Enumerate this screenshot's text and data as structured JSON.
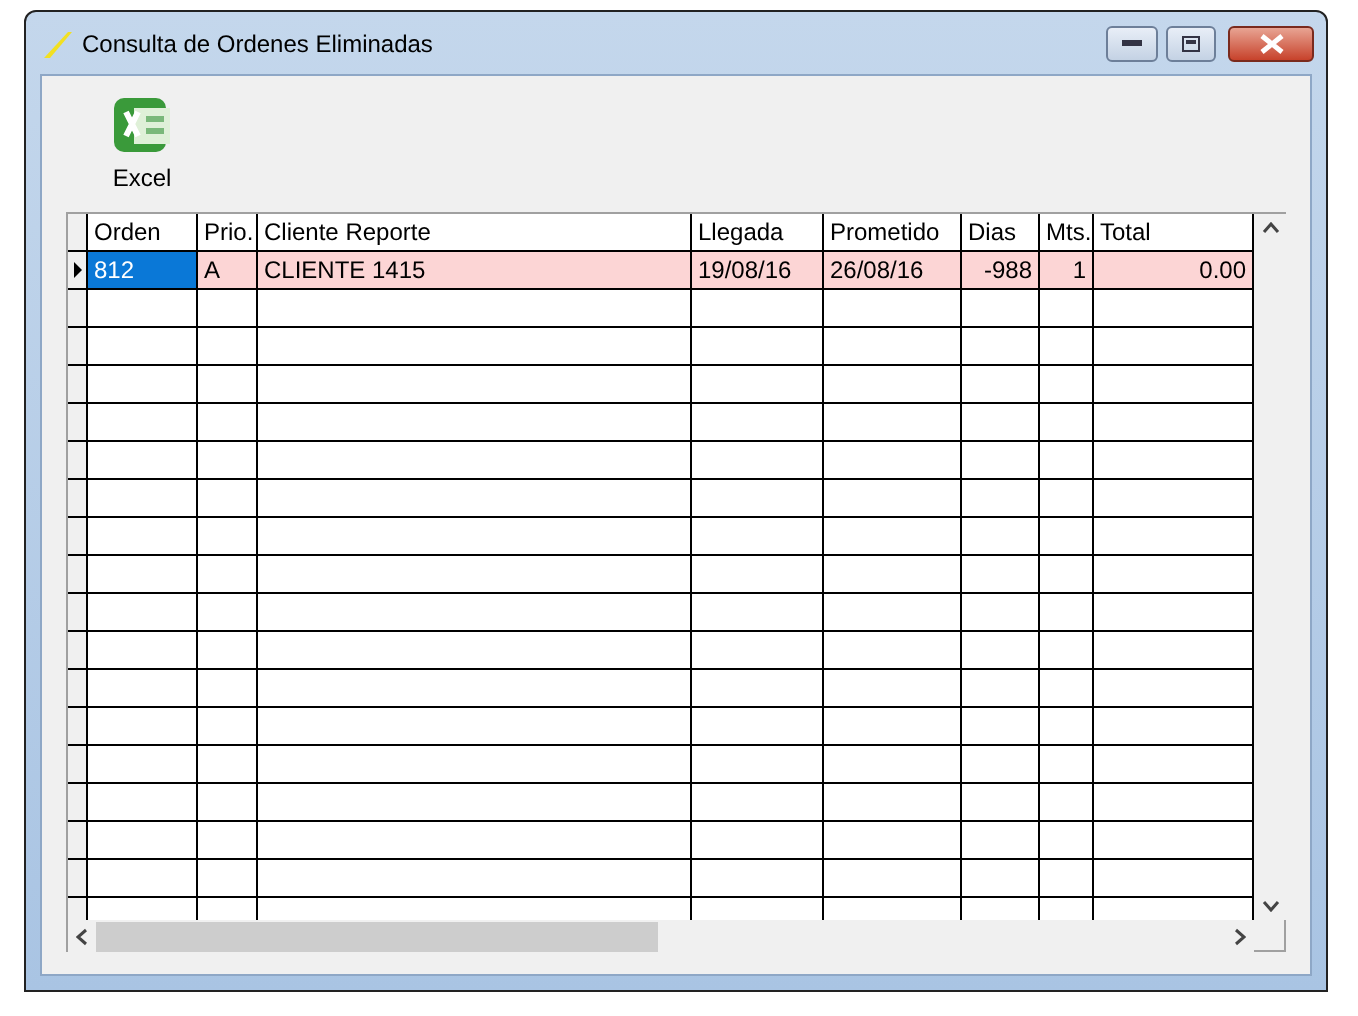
{
  "window": {
    "title": "Consulta de Ordenes Eliminadas"
  },
  "toolbar": [
    {
      "label": "Excel"
    }
  ],
  "table": {
    "columns": [
      "Orden",
      "Prio.",
      "Cliente Reporte",
      "Llegada",
      "Prometido",
      "Dias",
      "Mts.",
      "Total"
    ],
    "rows": [
      {
        "selected": true,
        "cells": [
          "812",
          "A",
          "CLIENTE 1415",
          "19/08/16",
          "26/08/16",
          "-988",
          "1",
          "0.00"
        ]
      }
    ]
  }
}
